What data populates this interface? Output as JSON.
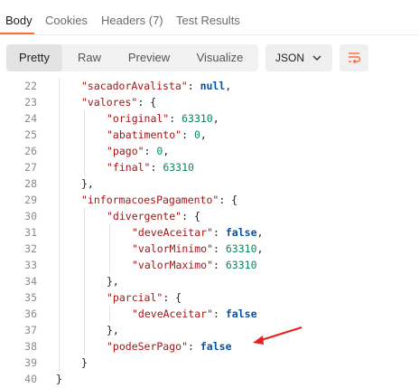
{
  "tabs": [
    {
      "label": "Body",
      "active": true
    },
    {
      "label": "Cookies",
      "active": false
    },
    {
      "label": "Headers (7)",
      "active": false
    },
    {
      "label": "Test Results",
      "active": false
    }
  ],
  "toolbar": {
    "views": [
      {
        "label": "Pretty",
        "active": true
      },
      {
        "label": "Raw",
        "active": false
      },
      {
        "label": "Preview",
        "active": false
      },
      {
        "label": "Visualize",
        "active": false
      }
    ],
    "format": "JSON",
    "format_icon": "chevron-down-icon",
    "wrap_icon": "wrap-lines-icon"
  },
  "colors": {
    "accent": "#ff6c37",
    "key": "#a31515",
    "number": "#098658",
    "boolean": "#0451a5",
    "annotation_arrow": "#e8211f"
  },
  "code": {
    "lines": [
      {
        "n": "22",
        "indent": 2,
        "parts": [
          [
            "k",
            "\"sacadorAvalista\""
          ],
          [
            "p",
            ": "
          ],
          [
            "b",
            "null"
          ],
          [
            "p",
            ","
          ]
        ]
      },
      {
        "n": "23",
        "indent": 2,
        "parts": [
          [
            "k",
            "\"valores\""
          ],
          [
            "p",
            ": {"
          ]
        ]
      },
      {
        "n": "24",
        "indent": 3,
        "parts": [
          [
            "k",
            "\"original\""
          ],
          [
            "p",
            ": "
          ],
          [
            "n",
            "63310"
          ],
          [
            "p",
            ","
          ]
        ]
      },
      {
        "n": "25",
        "indent": 3,
        "parts": [
          [
            "k",
            "\"abatimento\""
          ],
          [
            "p",
            ": "
          ],
          [
            "n",
            "0"
          ],
          [
            "p",
            ","
          ]
        ]
      },
      {
        "n": "26",
        "indent": 3,
        "parts": [
          [
            "k",
            "\"pago\""
          ],
          [
            "p",
            ": "
          ],
          [
            "n",
            "0"
          ],
          [
            "p",
            ","
          ]
        ]
      },
      {
        "n": "27",
        "indent": 3,
        "parts": [
          [
            "k",
            "\"final\""
          ],
          [
            "p",
            ": "
          ],
          [
            "n",
            "63310"
          ]
        ]
      },
      {
        "n": "28",
        "indent": 2,
        "parts": [
          [
            "p",
            "},"
          ]
        ]
      },
      {
        "n": "29",
        "indent": 2,
        "parts": [
          [
            "k",
            "\"informacoesPagamento\""
          ],
          [
            "p",
            ": {"
          ]
        ]
      },
      {
        "n": "30",
        "indent": 3,
        "parts": [
          [
            "k",
            "\"divergente\""
          ],
          [
            "p",
            ": {"
          ]
        ]
      },
      {
        "n": "31",
        "indent": 4,
        "parts": [
          [
            "k",
            "\"deveAceitar\""
          ],
          [
            "p",
            ": "
          ],
          [
            "b",
            "false"
          ],
          [
            "p",
            ","
          ]
        ]
      },
      {
        "n": "32",
        "indent": 4,
        "parts": [
          [
            "k",
            "\"valorMinimo\""
          ],
          [
            "p",
            ": "
          ],
          [
            "n",
            "63310"
          ],
          [
            "p",
            ","
          ]
        ]
      },
      {
        "n": "33",
        "indent": 4,
        "parts": [
          [
            "k",
            "\"valorMaximo\""
          ],
          [
            "p",
            ": "
          ],
          [
            "n",
            "63310"
          ]
        ]
      },
      {
        "n": "34",
        "indent": 3,
        "parts": [
          [
            "p",
            "},"
          ]
        ]
      },
      {
        "n": "35",
        "indent": 3,
        "parts": [
          [
            "k",
            "\"parcial\""
          ],
          [
            "p",
            ": {"
          ]
        ]
      },
      {
        "n": "36",
        "indent": 4,
        "parts": [
          [
            "k",
            "\"deveAceitar\""
          ],
          [
            "p",
            ": "
          ],
          [
            "b",
            "false"
          ]
        ]
      },
      {
        "n": "37",
        "indent": 3,
        "parts": [
          [
            "p",
            "},"
          ]
        ]
      },
      {
        "n": "38",
        "indent": 3,
        "parts": [
          [
            "k",
            "\"podeSerPago\""
          ],
          [
            "p",
            ": "
          ],
          [
            "b",
            "false"
          ]
        ]
      },
      {
        "n": "39",
        "indent": 2,
        "parts": [
          [
            "p",
            "}"
          ]
        ]
      },
      {
        "n": "40",
        "indent": 1,
        "parts": [
          [
            "p",
            "}"
          ]
        ]
      }
    ]
  }
}
